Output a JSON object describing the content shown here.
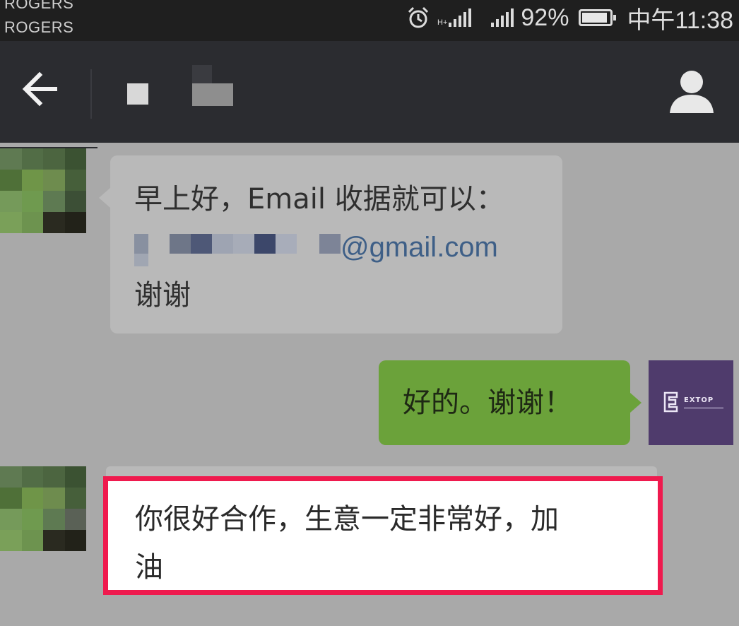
{
  "status_bar": {
    "carrier_line_1": "ROGERS",
    "carrier_line_2": "ROGERS",
    "network_type": "H+",
    "battery_percent": "92%",
    "battery_level": 0.92,
    "time": "中午11:38"
  },
  "header": {
    "back_icon": "arrow-left-icon",
    "profile_icon": "person-icon"
  },
  "messages": [
    {
      "direction": "incoming",
      "line1": "早上好，Email 收据就可以：",
      "email_domain": "@gmail.com",
      "line3": "谢谢"
    },
    {
      "direction": "outgoing",
      "text": "好的。谢谢！",
      "avatar_brand": "EXTOP"
    },
    {
      "direction": "incoming",
      "line1": "你很好合作，生意一定非常好，加",
      "line2": "油",
      "highlighted": true
    }
  ],
  "colors": {
    "status_bar": "#1f1f1f",
    "title_bar": "#2b2c30",
    "chat_background": "#a9a9a9",
    "incoming_bubble": "#b9b9b9",
    "outgoing_bubble": "#6ba23a",
    "highlight_border": "#ef1a4e",
    "link": "#3e5f87"
  }
}
